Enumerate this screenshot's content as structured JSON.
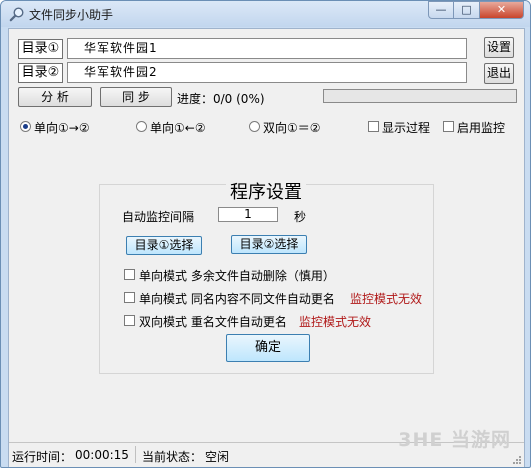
{
  "window": {
    "title": "文件同步小助手",
    "minimize_symbol": "—",
    "maximize_symbol": "□",
    "close_symbol": "✕"
  },
  "dirs": {
    "dir1_label": "目录①",
    "dir1_value": "华军软件园1",
    "dir2_label": "目录②",
    "dir2_value": "华军软件园2"
  },
  "toolbar": {
    "settings_label": "设置",
    "exit_label": "退出",
    "analyze_label": "分  析",
    "sync_label": "同  步",
    "progress_text": "进度：0/0  (0%)",
    "progress_fraction": 0
  },
  "options": {
    "radio1_label": "单向①→②",
    "radio2_label": "单向①←②",
    "radio3_label": "双向①＝②",
    "selected_radio": 1,
    "show_process_label": "显示过程",
    "enable_monitor_label": "启用监控"
  },
  "settings_panel": {
    "title": "程序设置",
    "interval_label": "自动监控间隔",
    "interval_value": "1",
    "interval_unit": "秒",
    "select_dir1_label": "目录①选择",
    "select_dir2_label": "目录②选择",
    "option1_label": "单向模式  多余文件自动删除（慎用）",
    "option2_label": "单向模式  同名内容不同文件自动更名",
    "option2_note": "监控模式无效",
    "option3_label": "双向模式  重名文件自动更名",
    "option3_note": "监控模式无效",
    "confirm_label": "确定"
  },
  "status": {
    "runtime_label": "运行时间：",
    "runtime_value": "00:00:15",
    "state_label": "当前状态：",
    "state_value": "空闲"
  },
  "watermark": {
    "text": "当游网",
    "logo_text": "3HE"
  },
  "colors": {
    "accent_red": "#b01818",
    "progress_green": "#3cb043",
    "titlebar": "#c2d6ee"
  },
  "icons": {
    "app": "magnifier-icon",
    "grip": "resize-grip-icon"
  }
}
